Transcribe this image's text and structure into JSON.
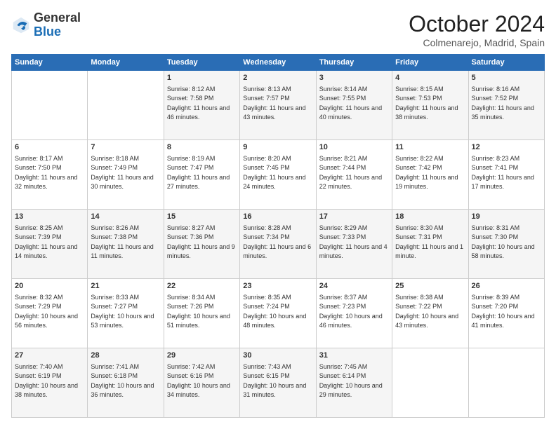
{
  "logo": {
    "general": "General",
    "blue": "Blue"
  },
  "header": {
    "month": "October 2024",
    "location": "Colmenarejo, Madrid, Spain"
  },
  "weekdays": [
    "Sunday",
    "Monday",
    "Tuesday",
    "Wednesday",
    "Thursday",
    "Friday",
    "Saturday"
  ],
  "weeks": [
    [
      {
        "day": null
      },
      {
        "day": null
      },
      {
        "day": 1,
        "sunrise": "8:12 AM",
        "sunset": "7:58 PM",
        "daylight": "11 hours and 46 minutes."
      },
      {
        "day": 2,
        "sunrise": "8:13 AM",
        "sunset": "7:57 PM",
        "daylight": "11 hours and 43 minutes."
      },
      {
        "day": 3,
        "sunrise": "8:14 AM",
        "sunset": "7:55 PM",
        "daylight": "11 hours and 40 minutes."
      },
      {
        "day": 4,
        "sunrise": "8:15 AM",
        "sunset": "7:53 PM",
        "daylight": "11 hours and 38 minutes."
      },
      {
        "day": 5,
        "sunrise": "8:16 AM",
        "sunset": "7:52 PM",
        "daylight": "11 hours and 35 minutes."
      }
    ],
    [
      {
        "day": 6,
        "sunrise": "8:17 AM",
        "sunset": "7:50 PM",
        "daylight": "11 hours and 32 minutes."
      },
      {
        "day": 7,
        "sunrise": "8:18 AM",
        "sunset": "7:49 PM",
        "daylight": "11 hours and 30 minutes."
      },
      {
        "day": 8,
        "sunrise": "8:19 AM",
        "sunset": "7:47 PM",
        "daylight": "11 hours and 27 minutes."
      },
      {
        "day": 9,
        "sunrise": "8:20 AM",
        "sunset": "7:45 PM",
        "daylight": "11 hours and 24 minutes."
      },
      {
        "day": 10,
        "sunrise": "8:21 AM",
        "sunset": "7:44 PM",
        "daylight": "11 hours and 22 minutes."
      },
      {
        "day": 11,
        "sunrise": "8:22 AM",
        "sunset": "7:42 PM",
        "daylight": "11 hours and 19 minutes."
      },
      {
        "day": 12,
        "sunrise": "8:23 AM",
        "sunset": "7:41 PM",
        "daylight": "11 hours and 17 minutes."
      }
    ],
    [
      {
        "day": 13,
        "sunrise": "8:25 AM",
        "sunset": "7:39 PM",
        "daylight": "11 hours and 14 minutes."
      },
      {
        "day": 14,
        "sunrise": "8:26 AM",
        "sunset": "7:38 PM",
        "daylight": "11 hours and 11 minutes."
      },
      {
        "day": 15,
        "sunrise": "8:27 AM",
        "sunset": "7:36 PM",
        "daylight": "11 hours and 9 minutes."
      },
      {
        "day": 16,
        "sunrise": "8:28 AM",
        "sunset": "7:34 PM",
        "daylight": "11 hours and 6 minutes."
      },
      {
        "day": 17,
        "sunrise": "8:29 AM",
        "sunset": "7:33 PM",
        "daylight": "11 hours and 4 minutes."
      },
      {
        "day": 18,
        "sunrise": "8:30 AM",
        "sunset": "7:31 PM",
        "daylight": "11 hours and 1 minute."
      },
      {
        "day": 19,
        "sunrise": "8:31 AM",
        "sunset": "7:30 PM",
        "daylight": "10 hours and 58 minutes."
      }
    ],
    [
      {
        "day": 20,
        "sunrise": "8:32 AM",
        "sunset": "7:29 PM",
        "daylight": "10 hours and 56 minutes."
      },
      {
        "day": 21,
        "sunrise": "8:33 AM",
        "sunset": "7:27 PM",
        "daylight": "10 hours and 53 minutes."
      },
      {
        "day": 22,
        "sunrise": "8:34 AM",
        "sunset": "7:26 PM",
        "daylight": "10 hours and 51 minutes."
      },
      {
        "day": 23,
        "sunrise": "8:35 AM",
        "sunset": "7:24 PM",
        "daylight": "10 hours and 48 minutes."
      },
      {
        "day": 24,
        "sunrise": "8:37 AM",
        "sunset": "7:23 PM",
        "daylight": "10 hours and 46 minutes."
      },
      {
        "day": 25,
        "sunrise": "8:38 AM",
        "sunset": "7:22 PM",
        "daylight": "10 hours and 43 minutes."
      },
      {
        "day": 26,
        "sunrise": "8:39 AM",
        "sunset": "7:20 PM",
        "daylight": "10 hours and 41 minutes."
      }
    ],
    [
      {
        "day": 27,
        "sunrise": "7:40 AM",
        "sunset": "6:19 PM",
        "daylight": "10 hours and 38 minutes."
      },
      {
        "day": 28,
        "sunrise": "7:41 AM",
        "sunset": "6:18 PM",
        "daylight": "10 hours and 36 minutes."
      },
      {
        "day": 29,
        "sunrise": "7:42 AM",
        "sunset": "6:16 PM",
        "daylight": "10 hours and 34 minutes."
      },
      {
        "day": 30,
        "sunrise": "7:43 AM",
        "sunset": "6:15 PM",
        "daylight": "10 hours and 31 minutes."
      },
      {
        "day": 31,
        "sunrise": "7:45 AM",
        "sunset": "6:14 PM",
        "daylight": "10 hours and 29 minutes."
      },
      {
        "day": null
      },
      {
        "day": null
      }
    ]
  ]
}
